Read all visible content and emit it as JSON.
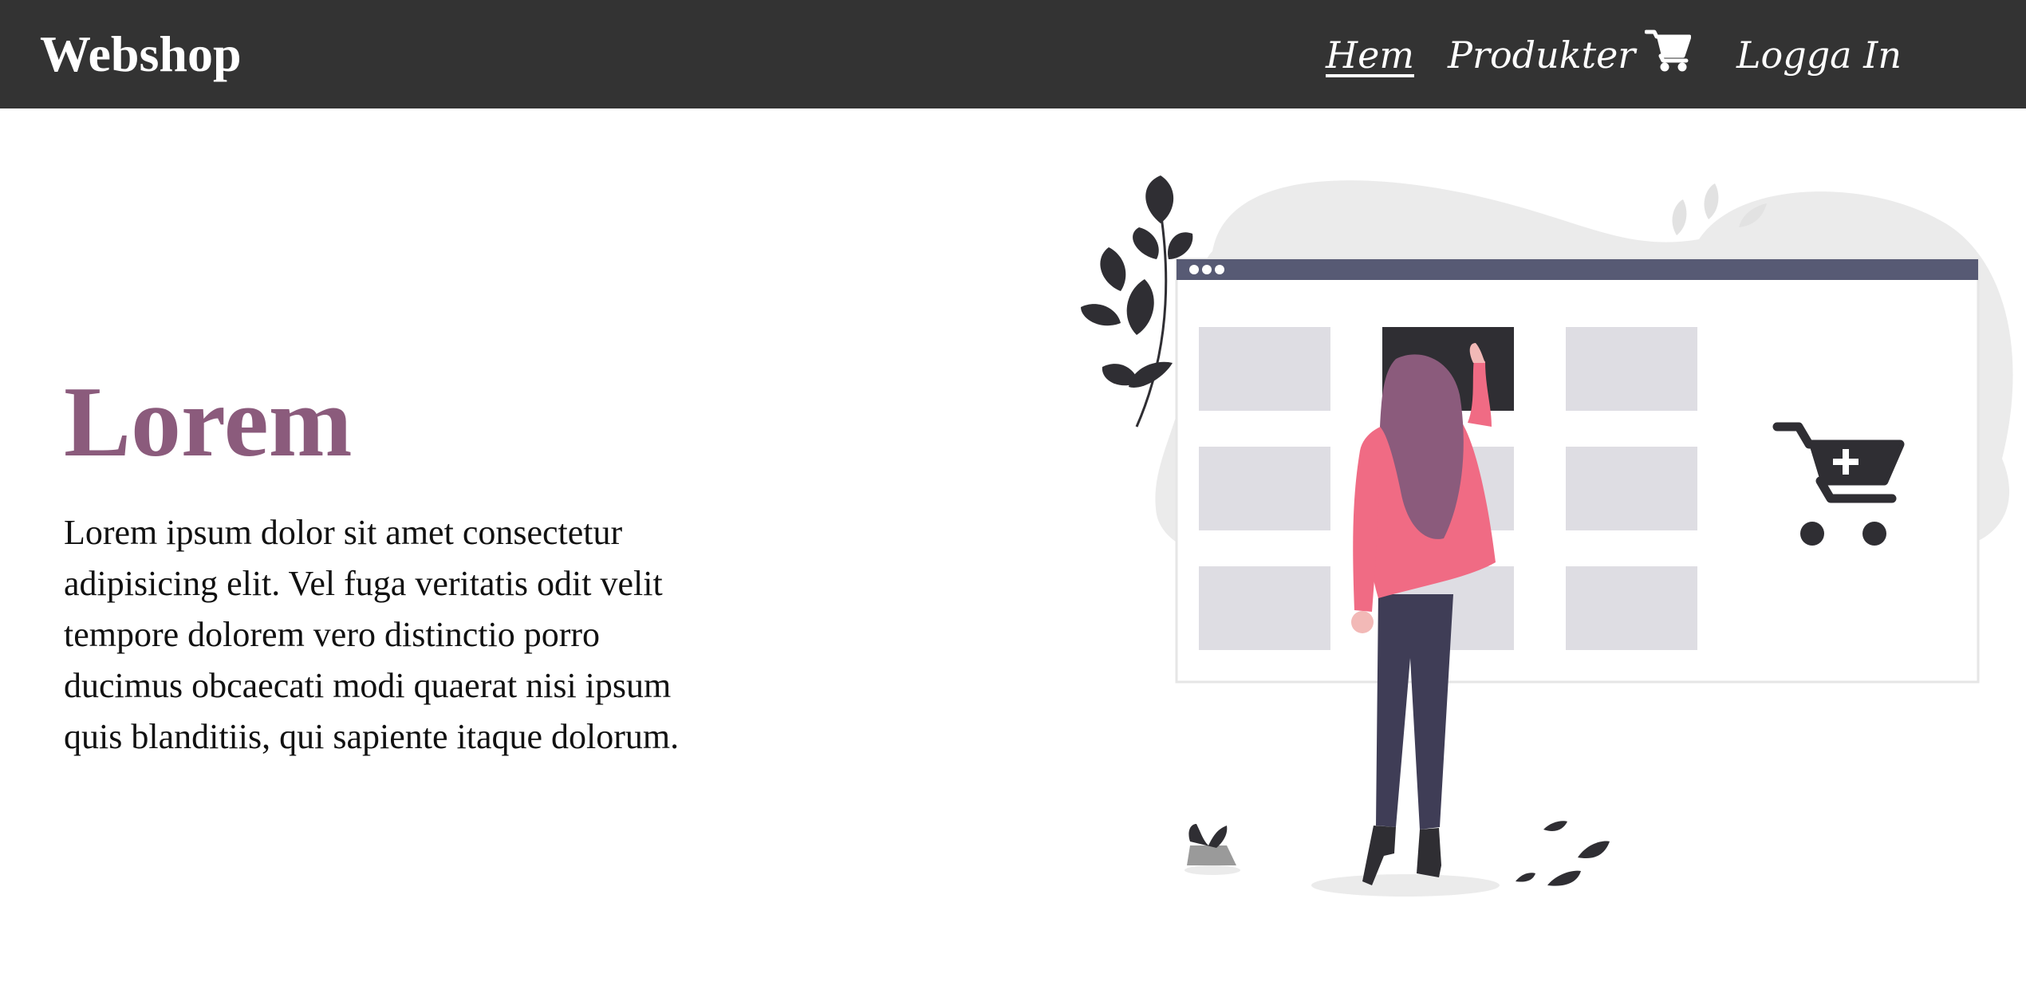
{
  "header": {
    "brand": "Webshop",
    "nav": {
      "home": "Hem",
      "products": "Produkter",
      "cart_icon": "shopping-cart-icon",
      "login": "Logga In"
    }
  },
  "hero": {
    "title": "Lorem",
    "text": "Lorem ipsum dolor sit amet consectetur adipisicing elit. Vel fuga veritatis odit velit tempore dolorem vero distinctio porro ducimus obcaecati modi quaerat nisi ipsum quis blanditiis, qui sapiente itaque dolorum."
  },
  "illustration": {
    "icon": "online-shopping-illustration",
    "cart_icon": "add-to-cart-icon"
  },
  "colors": {
    "navbar": "#333333",
    "title": "#8b5b7c",
    "accent_pink": "#f06b84",
    "window_bar": "#575a74"
  }
}
